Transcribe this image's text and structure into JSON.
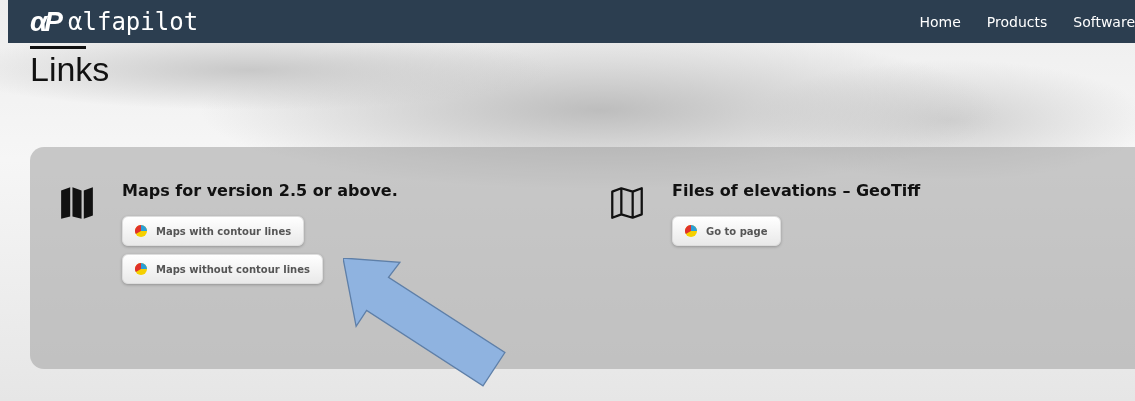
{
  "brand": {
    "mark": "αP",
    "name": "αlfapilot"
  },
  "nav": [
    {
      "label": "Home"
    },
    {
      "label": "Products"
    },
    {
      "label": "Software"
    }
  ],
  "heading": "Links",
  "sections": [
    {
      "kind": "filled",
      "title": "Maps for version 2.5 or above.",
      "links": [
        "Maps with contour lines",
        "Maps without contour lines"
      ]
    },
    {
      "kind": "outline",
      "title": "Files of elevations – GeoTiff",
      "links": [
        "Go to page"
      ]
    }
  ]
}
